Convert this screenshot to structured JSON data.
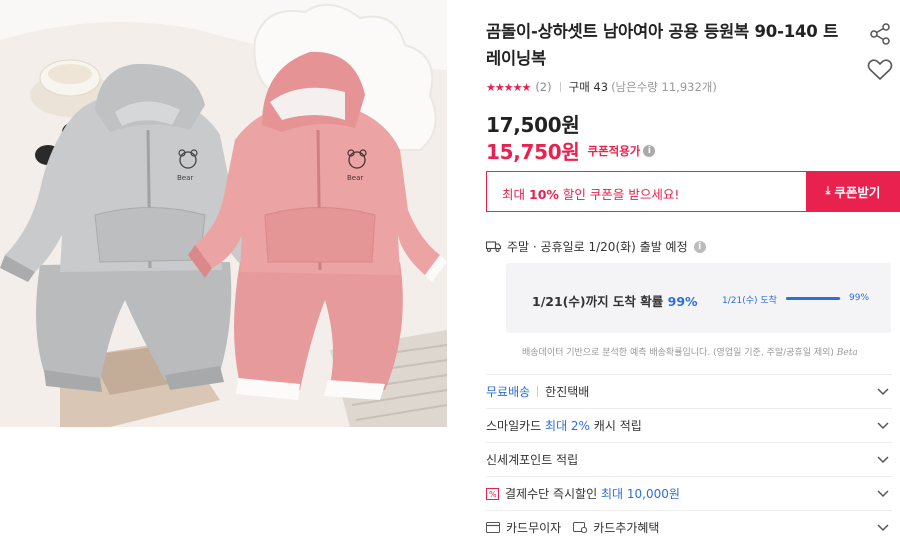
{
  "product": {
    "title": "곰돌이-상하셋트 남아여아 공용 등원복 90-140 트레이닝복",
    "stars": "★★★★★",
    "review_count": "(2)",
    "buy_count": "구매 43",
    "remaining": "(남은수량 11,932개)",
    "original_price": "17,500원",
    "sale_price": "15,750원",
    "coupon_applied_label": "쿠폰적용가",
    "image_badge_text": "Bear"
  },
  "coupon": {
    "prefix": "최대",
    "percent": "10%",
    "suffix": "할인 쿠폰을 받으세요!",
    "button_label": "쿠폰받기"
  },
  "shipping": {
    "schedule": "주말 · 공휴일로 1/20(화) 출발 예정",
    "arrival_text": "1/21(수)까지 도착 확률",
    "arrival_pct": "99%",
    "mini_date": "1/21(수) 도착",
    "mini_pct": "99%",
    "mini_fill": 0.99,
    "note": "배송데이터 기반으로 분석한 예측 배송확률입니다. (영업일 기준, 주말/공휴일 제외)",
    "beta": "Beta"
  },
  "benefits": {
    "free_shipping": "무료배송",
    "courier": "한진택배",
    "smile_prefix": "스마일카드",
    "smile_highlight": "최대 2%",
    "smile_suffix": "캐시 적립",
    "shinsegae": "신세계포인트 적립",
    "payment_prefix": "결제수단 즉시할인",
    "payment_highlight": "최대 10,000원",
    "card_interest": "카드무이자",
    "card_extra": "카드추가혜택"
  },
  "colors": {
    "accent": "#e8214e",
    "blue": "#2d6fd6"
  }
}
